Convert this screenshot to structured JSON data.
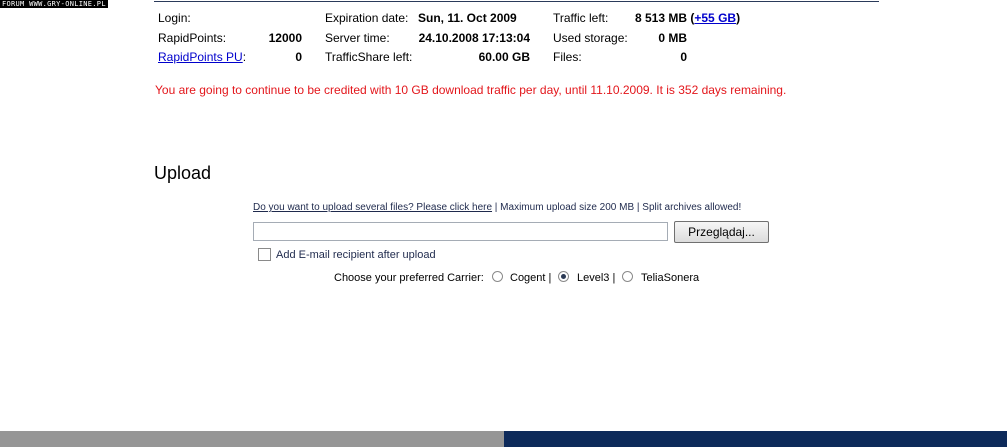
{
  "watermark": "FORUM WWW.GRY-ONLINE.PL",
  "account": {
    "login_label": "Login:",
    "rapidpoints_label": "RapidPoints:",
    "rapidpoints_value": "12000",
    "rapidpoints_pu_label": "RapidPoints PU",
    "rapidpoints_pu_colon": ":",
    "rapidpoints_pu_value": "0",
    "expiration_label": "Expiration date:",
    "expiration_value": "Sun, 11. Oct 2009",
    "server_time_label": "Server time:",
    "server_time_value": "24.10.2008 17:13:04",
    "trafficshare_label": "TrafficShare left:",
    "trafficshare_value": "60.00 GB",
    "traffic_left_label": "Traffic left:",
    "traffic_left_value": "8 513 MB",
    "traffic_left_open": "(",
    "traffic_left_link": "+55 GB",
    "traffic_left_close": ")",
    "used_storage_label": "Used storage:",
    "used_storage_value": "0 MB",
    "files_label": "Files:",
    "files_value": "0"
  },
  "notice": "You are going to continue to be credited with 10 GB download traffic per day, until 11.10.2009. It is 352 days remaining.",
  "upload": {
    "title": "Upload",
    "several_files_link": "Do you want to upload several files? Please click here",
    "info_rest": " | Maximum upload size 200 MB | Split archives allowed!",
    "file_value": "",
    "browse_label": "Przeglądaj...",
    "email_recipient_label": "Add E-mail recipient after upload",
    "carrier_prompt": "Choose your preferred Carrier:",
    "carriers": [
      {
        "label": "Cogent |",
        "selected": false
      },
      {
        "label": "Level3 |",
        "selected": true
      },
      {
        "label": "TeliaSonera",
        "selected": false
      }
    ]
  },
  "colors": {
    "notice": "#e3161b",
    "link": "#0000cc",
    "footer_gray": "#969696",
    "footer_navy": "#0d2a5a"
  }
}
